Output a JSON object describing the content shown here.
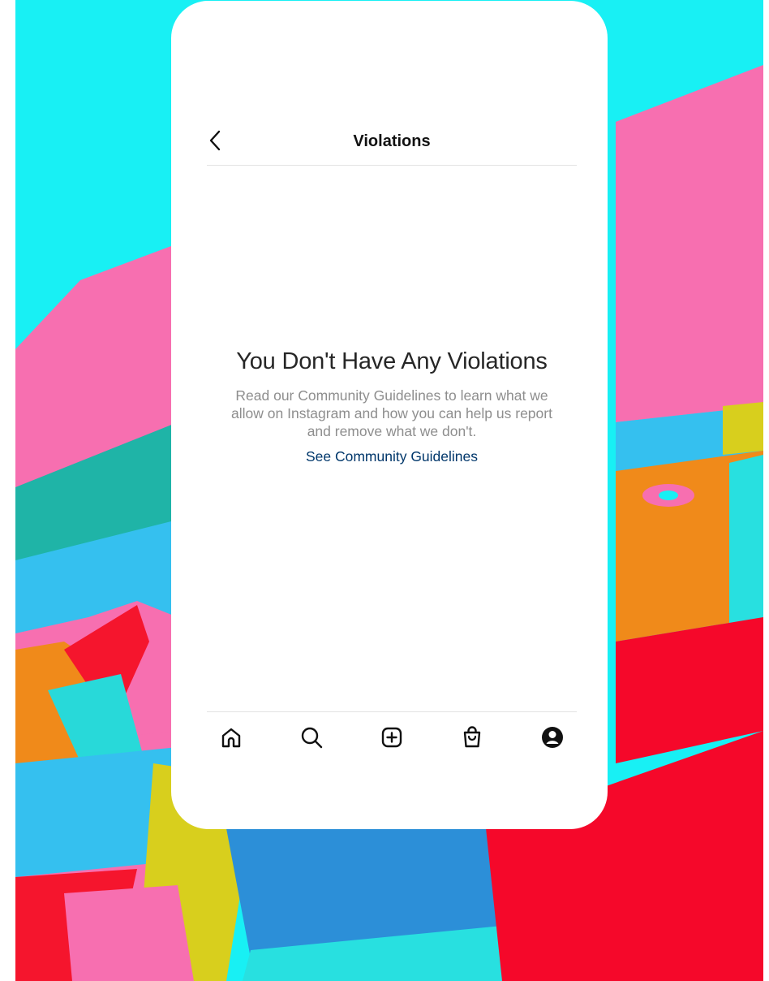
{
  "nav": {
    "title": "Violations",
    "back_icon": "chevron-left-icon"
  },
  "empty_state": {
    "heading": "You Don't Have Any Violations",
    "body": "Read our Community Guidelines to learn what we allow on Instagram and how you can help us report and remove what we don't.",
    "link_label": "See Community Guidelines",
    "link_color": "#00376b"
  },
  "tab_bar": {
    "tabs": [
      {
        "icon": "home-icon"
      },
      {
        "icon": "search-icon"
      },
      {
        "icon": "create-icon"
      },
      {
        "icon": "shop-icon"
      },
      {
        "icon": "profile-icon"
      }
    ]
  },
  "colors": {
    "background_accent": "#18f0f4",
    "card": "#ffffff"
  }
}
